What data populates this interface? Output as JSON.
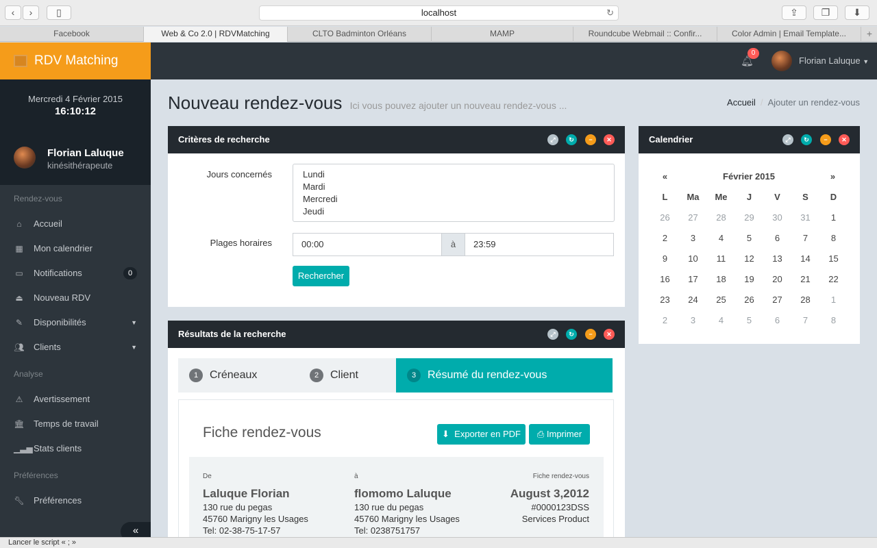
{
  "browser": {
    "url": "localhost",
    "tabs": [
      "Facebook",
      "Web & Co 2.0 | RDVMatching",
      "CLTO Badminton Orléans",
      "MAMP",
      "Roundcube Webmail :: Confir...",
      "Color Admin | Email Template..."
    ],
    "status": "Lancer le script « ; »"
  },
  "app": {
    "brand": "RDV Matching",
    "colors": {
      "accent": "#f59c1a",
      "teal": "#00acac",
      "dark": "#2d353c"
    }
  },
  "sidebar": {
    "date": "Mercredi 4 Février 2015",
    "time": "16:10:12",
    "user_name": "Florian Laluque",
    "user_role": "kinésithérapeute",
    "section_rdv": "Rendez-vous",
    "section_analyse": "Analyse",
    "section_prefs": "Préférences",
    "items": [
      {
        "label": "Accueil",
        "icon": "home-icon"
      },
      {
        "label": "Mon calendrier",
        "icon": "calendar-icon"
      },
      {
        "label": "Notifications",
        "icon": "inbox-icon",
        "badge": "0"
      },
      {
        "label": "Nouveau RDV",
        "icon": "eject-icon"
      },
      {
        "label": "Disponibilités",
        "icon": "pencil-icon"
      },
      {
        "label": "Clients",
        "icon": "users-icon"
      },
      {
        "label": "Avertissement",
        "icon": "warning-icon"
      },
      {
        "label": "Temps de travail",
        "icon": "bank-icon"
      },
      {
        "label": "Stats clients",
        "icon": "signal-icon"
      },
      {
        "label": "Préférences",
        "icon": "wrench-icon"
      }
    ],
    "collapse_glyph": "«"
  },
  "topbar": {
    "notif_count": "0",
    "user_name": "Florian Laluque"
  },
  "page": {
    "title": "Nouveau rendez-vous",
    "subtitle": "Ici vous pouvez ajouter un nouveau rendez-vous ...",
    "breadcrumb": [
      "Accueil",
      "Ajouter un rendez-vous"
    ]
  },
  "search_panel": {
    "title": "Critères de recherche",
    "days_label": "Jours concernés",
    "days": [
      "Lundi",
      "Mardi",
      "Mercredi",
      "Jeudi"
    ],
    "hours_label": "Plages horaires",
    "from": "00:00",
    "sep": "à",
    "to": "23:59",
    "submit": "Rechercher"
  },
  "results_panel": {
    "title": "Résultats de la recherche",
    "steps": [
      {
        "num": "1",
        "label": "Créneaux"
      },
      {
        "num": "2",
        "label": "Client"
      },
      {
        "num": "3",
        "label": "Résumé du rendez-vous"
      }
    ],
    "sheet_title": "Fiche rendez-vous",
    "export_pdf": "Exporter en PDF",
    "print": "Imprimer",
    "from_block": {
      "label": "De",
      "name": "Laluque Florian",
      "street": "130 rue du pegas",
      "city": "45760 Marigny les Usages",
      "tel": "Tel: 02-38-75-17-57"
    },
    "to_block": {
      "label": "à",
      "name": "flomomo Laluque",
      "street": "130 rue du pegas",
      "city": "45760 Marigny les Usages",
      "tel": "Tel: 0238751757"
    },
    "sheet_block": {
      "label": "Fiche rendez-vous",
      "date": "August 3,2012",
      "ref": "#0000123DSS",
      "service": "Services Product"
    }
  },
  "calendar": {
    "title": "Calendrier",
    "prev": "«",
    "month": "Février 2015",
    "next": "»",
    "weekdays": [
      "L",
      "Ma",
      "Me",
      "J",
      "V",
      "S",
      "D"
    ],
    "weeks": [
      [
        "26",
        "27",
        "28",
        "29",
        "30",
        "31",
        "1"
      ],
      [
        "2",
        "3",
        "4",
        "5",
        "6",
        "7",
        "8"
      ],
      [
        "9",
        "10",
        "11",
        "12",
        "13",
        "14",
        "15"
      ],
      [
        "16",
        "17",
        "18",
        "19",
        "20",
        "21",
        "22"
      ],
      [
        "23",
        "24",
        "25",
        "26",
        "27",
        "28",
        "1"
      ],
      [
        "2",
        "3",
        "4",
        "5",
        "6",
        "7",
        "8"
      ]
    ]
  }
}
